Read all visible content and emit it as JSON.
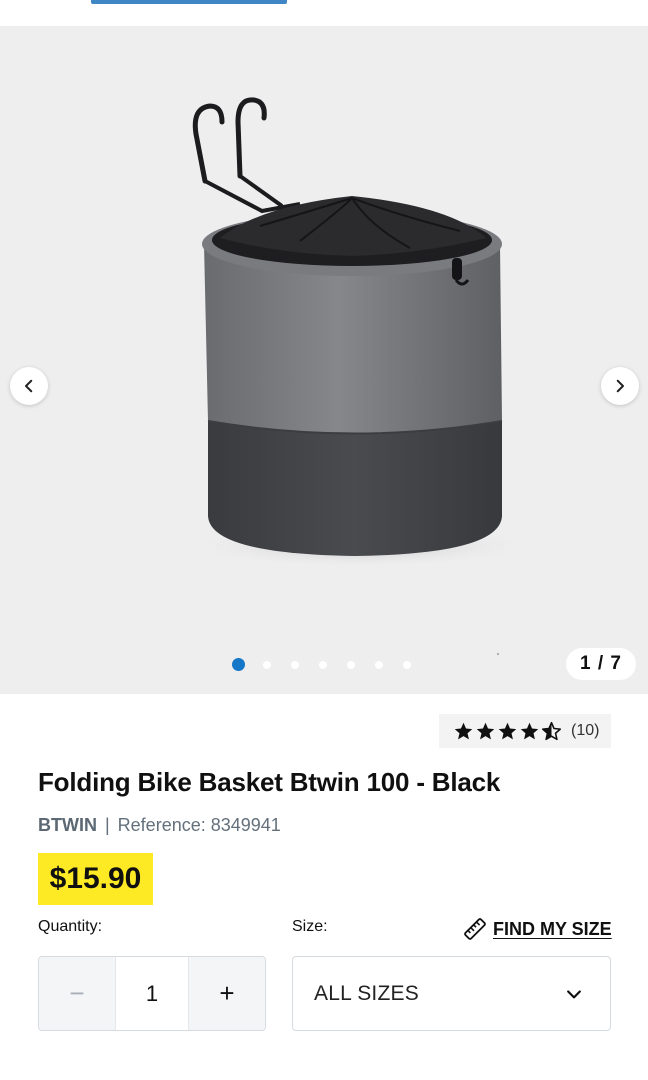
{
  "gallery": {
    "counter": "1 / 7",
    "total_images": 7,
    "active_index": 0
  },
  "rating": {
    "stars_value": 4.5,
    "stars_max": 5,
    "count_label": "(10)"
  },
  "product": {
    "title": "Folding Bike Basket Btwin 100 - Black",
    "brand": "BTWIN",
    "separator": "|",
    "reference": "Reference: 8349941",
    "price": "$15.90"
  },
  "purchase": {
    "quantity_label": "Quantity:",
    "quantity_value": "1",
    "minus_symbol": "−",
    "plus_symbol": "+",
    "size_label": "Size:",
    "find_size_label": "FIND MY SIZE",
    "size_value": "ALL SIZES"
  },
  "colors": {
    "accent_blue": "#1477c7",
    "price_yellow": "#fde924",
    "image_background": "#eeeeef"
  },
  "icons": {
    "prev": "chevron-left-icon",
    "next": "chevron-right-icon",
    "find_size": "ruler-icon",
    "dropdown": "chevron-down-icon",
    "star": "star-icon"
  }
}
